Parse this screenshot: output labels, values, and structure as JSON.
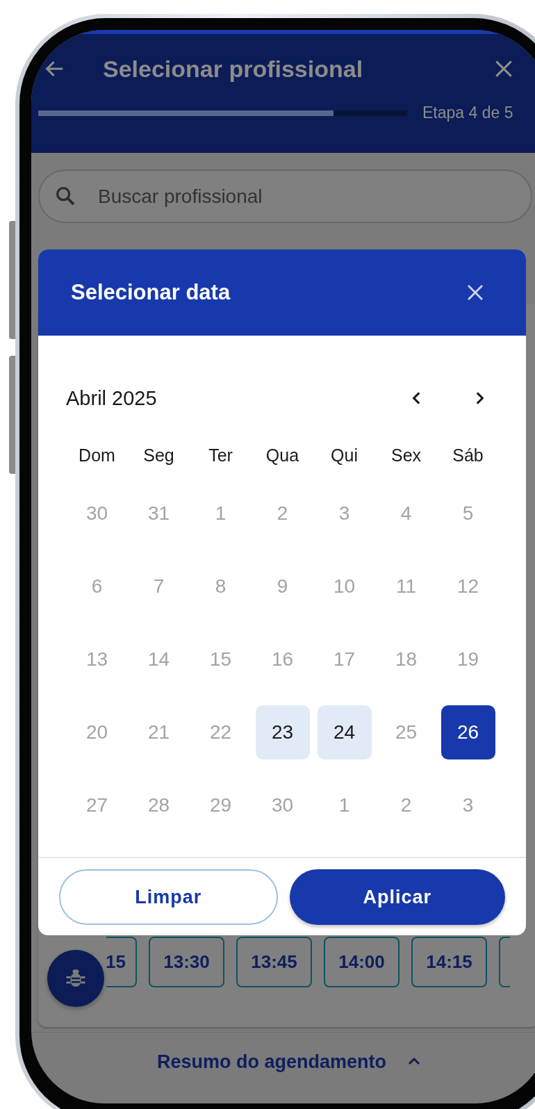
{
  "header": {
    "title": "Selecionar profissional",
    "progress": {
      "level": 0.8
    },
    "step": "Etapa 4 de 5"
  },
  "search": {
    "placeholder": "Buscar profissional"
  },
  "time_slots": [
    {
      "label": "15"
    },
    {
      "label": "13:30"
    },
    {
      "label": "13:45"
    },
    {
      "label": "14:00"
    },
    {
      "label": "14:15"
    }
  ],
  "summary": {
    "label": "Resumo do agendamento"
  },
  "date_dialog": {
    "title": "Selecionar data",
    "month": "Abril 2025",
    "weekdays": [
      "Dom",
      "Seg",
      "Ter",
      "Qua",
      "Qui",
      "Sex",
      "Sáb"
    ],
    "weeks": [
      [
        {
          "day": "30",
          "disabled": true,
          "selected": false
        },
        {
          "day": "31",
          "disabled": true,
          "selected": false
        },
        {
          "day": "1",
          "disabled": true,
          "selected": false
        },
        {
          "day": "2",
          "disabled": true,
          "selected": false
        },
        {
          "day": "3",
          "disabled": true,
          "selected": false
        },
        {
          "day": "4",
          "disabled": true,
          "selected": false
        },
        {
          "day": "5",
          "disabled": true,
          "selected": false
        }
      ],
      [
        {
          "day": "6",
          "disabled": true,
          "selected": false
        },
        {
          "day": "7",
          "disabled": true,
          "selected": false
        },
        {
          "day": "8",
          "disabled": true,
          "selected": false
        },
        {
          "day": "9",
          "disabled": true,
          "selected": false
        },
        {
          "day": "10",
          "disabled": true,
          "selected": false
        },
        {
          "day": "11",
          "disabled": true,
          "selected": false
        },
        {
          "day": "12",
          "disabled": true,
          "selected": false
        }
      ],
      [
        {
          "day": "13",
          "disabled": true,
          "selected": false
        },
        {
          "day": "14",
          "disabled": true,
          "selected": false
        },
        {
          "day": "15",
          "disabled": true,
          "selected": false
        },
        {
          "day": "16",
          "disabled": true,
          "selected": false
        },
        {
          "day": "17",
          "disabled": true,
          "selected": false
        },
        {
          "day": "18",
          "disabled": true,
          "selected": false
        },
        {
          "day": "19",
          "disabled": true,
          "selected": false
        }
      ],
      [
        {
          "day": "20",
          "disabled": true,
          "selected": false
        },
        {
          "day": "21",
          "disabled": true,
          "selected": false
        },
        {
          "day": "22",
          "disabled": true,
          "selected": false
        },
        {
          "day": "23",
          "disabled": false,
          "selected": false
        },
        {
          "day": "24",
          "disabled": false,
          "selected": false
        },
        {
          "day": "25",
          "disabled": true,
          "selected": false
        },
        {
          "day": "26",
          "disabled": false,
          "selected": true
        }
      ],
      [
        {
          "day": "27",
          "disabled": true,
          "selected": false
        },
        {
          "day": "28",
          "disabled": true,
          "selected": false
        },
        {
          "day": "29",
          "disabled": true,
          "selected": false
        },
        {
          "day": "30",
          "disabled": true,
          "selected": false
        },
        {
          "day": "1",
          "disabled": true,
          "selected": false
        },
        {
          "day": "2",
          "disabled": true,
          "selected": false
        },
        {
          "day": "3",
          "disabled": true,
          "selected": false
        }
      ]
    ],
    "buttons": [
      {
        "label": "Limpar",
        "kind": "outline"
      },
      {
        "label": "Aplicar",
        "kind": "primary"
      }
    ]
  }
}
